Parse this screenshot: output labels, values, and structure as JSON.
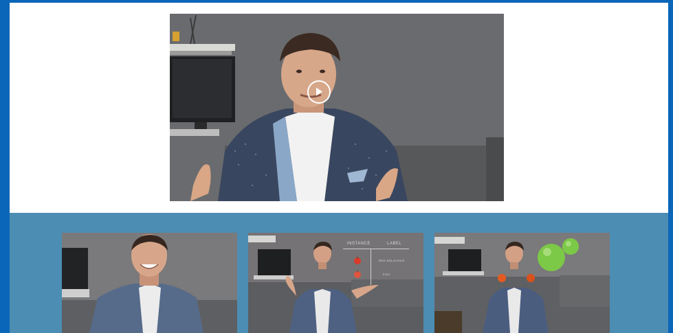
{
  "hero_video": {
    "play_icon": "play-circle-icon"
  },
  "thumbnails": [
    {
      "id": "thumb-1"
    },
    {
      "id": "thumb-2",
      "overlay": {
        "headers": [
          "INSTANCE",
          "LABEL"
        ],
        "rows": [
          {
            "icon": "apple-icon",
            "label": "RED DELICIOUS"
          },
          {
            "icon": "apple-icon",
            "label": "FUJI"
          }
        ]
      }
    },
    {
      "id": "thumb-3"
    }
  ],
  "colors": {
    "page_border": "#0a66b8",
    "bottom_band": "#4c8db3",
    "top_band": "#ffffff"
  }
}
